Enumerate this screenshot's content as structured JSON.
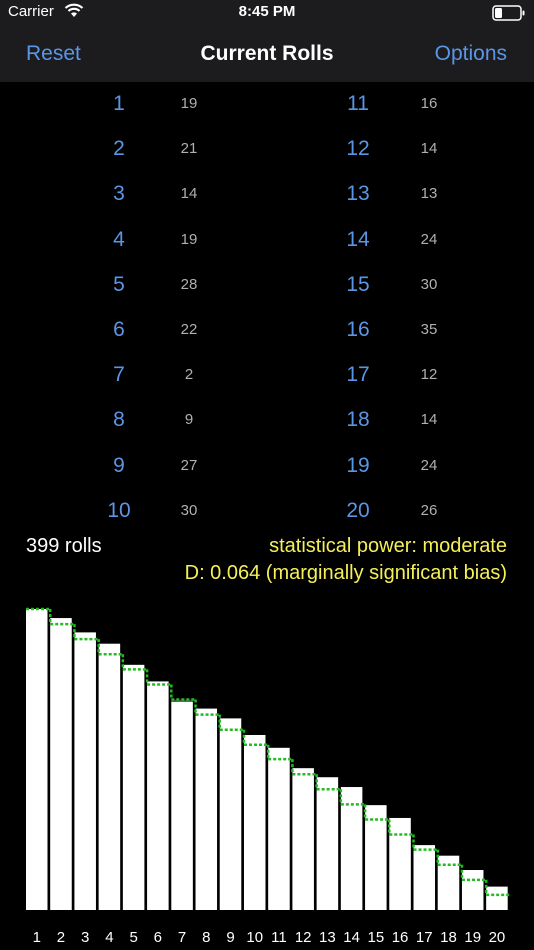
{
  "status": {
    "carrier": "Carrier",
    "time": "8:45 PM"
  },
  "nav": {
    "left": "Reset",
    "title": "Current Rolls",
    "right": "Options"
  },
  "rolls": [
    {
      "face": "1",
      "count": 19
    },
    {
      "face": "2",
      "count": 21
    },
    {
      "face": "3",
      "count": 14
    },
    {
      "face": "4",
      "count": 19
    },
    {
      "face": "5",
      "count": 28
    },
    {
      "face": "6",
      "count": 22
    },
    {
      "face": "7",
      "count": 2
    },
    {
      "face": "8",
      "count": 9
    },
    {
      "face": "9",
      "count": 27
    },
    {
      "face": "10",
      "count": 30
    },
    {
      "face": "11",
      "count": 16
    },
    {
      "face": "12",
      "count": 14
    },
    {
      "face": "13",
      "count": 13
    },
    {
      "face": "14",
      "count": 24
    },
    {
      "face": "15",
      "count": 30
    },
    {
      "face": "16",
      "count": 35
    },
    {
      "face": "17",
      "count": 12
    },
    {
      "face": "18",
      "count": 14
    },
    {
      "face": "19",
      "count": 24
    },
    {
      "face": "20",
      "count": 26
    }
  ],
  "summary": {
    "total": "399 rolls",
    "power": "statistical power: moderate",
    "d": "D: 0.064 (marginally significant bias)"
  },
  "colors": {
    "accent": "#5b96e6",
    "stat_text": "#f5f05a",
    "bar_fill": "#ffffff",
    "expected_bar": "#3c3c3c",
    "expected_line": "#22bb22"
  },
  "chart_data": {
    "type": "bar",
    "categories": [
      "1",
      "2",
      "3",
      "4",
      "5",
      "6",
      "7",
      "8",
      "9",
      "10",
      "11",
      "12",
      "13",
      "14",
      "15",
      "16",
      "17",
      "18",
      "19",
      "20"
    ],
    "series": [
      {
        "values": [
          399,
          387,
          368,
          353,
          325,
          303,
          276,
          267,
          254,
          232,
          215,
          188,
          176,
          163,
          139,
          122,
          86,
          72,
          53,
          31
        ]
      },
      {
        "values": [
          399,
          379,
          359,
          339,
          319,
          299,
          279,
          259,
          239,
          219,
          200,
          180,
          160,
          140,
          120,
          100,
          80,
          60,
          40,
          20
        ]
      },
      {
        "values": [
          399,
          379,
          359,
          339,
          319,
          299,
          279,
          259,
          239,
          219,
          200,
          180,
          160,
          140,
          120,
          100,
          80,
          60,
          40,
          20
        ]
      }
    ],
    "ylim": [
      0,
      399
    ],
    "grid": false,
    "legend": "none"
  }
}
